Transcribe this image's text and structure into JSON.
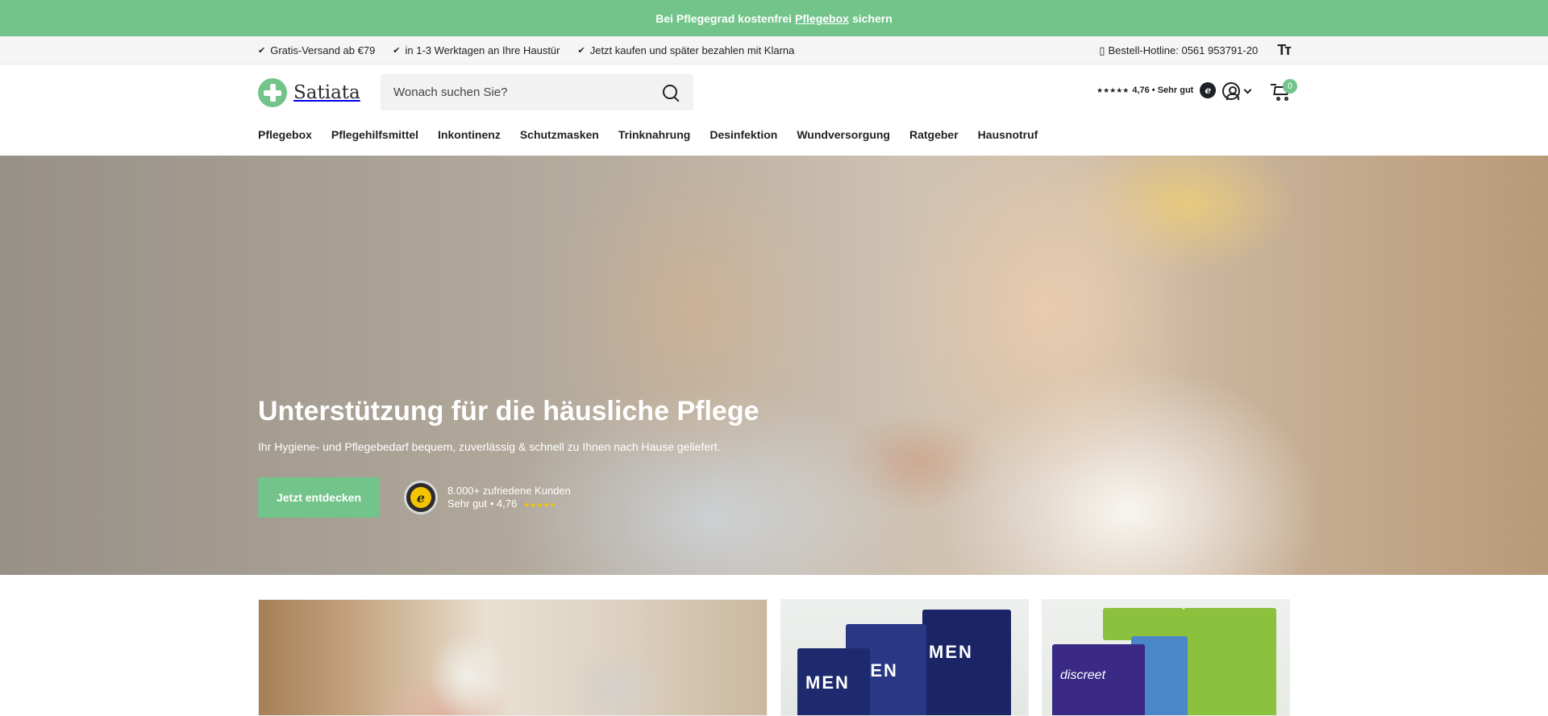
{
  "announcement": {
    "prefix": "Bei Pflegegrad kostenfrei",
    "link": "Pflegebox",
    "suffix": "sichern"
  },
  "usp": {
    "items": [
      "Gratis-Versand ab €79",
      "in 1-3 Werktagen an Ihre Haustür",
      "Jetzt kaufen und später bezahlen mit Klarna"
    ],
    "hotline_icon": "phone-icon",
    "hotline": "Bestell-Hotline: 0561 953791-20",
    "text_size_label": "Tт"
  },
  "header": {
    "logo_text": "Satiata",
    "search": {
      "placeholder": "Wonach suchen Sie?"
    },
    "rating": {
      "stars": "★★★★★",
      "text": "4,76 • Sehr gut",
      "badge": "e"
    },
    "cart_count": "0"
  },
  "nav": {
    "items": [
      "Pflegebox",
      "Pflegehilfsmittel",
      "Inkontinenz",
      "Schutzmasken",
      "Trinknahrung",
      "Desinfektion",
      "Wundversorgung",
      "Ratgeber",
      "Hausnotruf"
    ]
  },
  "hero": {
    "title": "Unterstützung für die häusliche Pflege",
    "subtitle": "Ihr Hygiene- und Pflegebedarf bequem, zuverlässig & schnell zu Ihnen nach Hause geliefert.",
    "cta": "Jetzt entdecken",
    "trust_line1": "8.000+ zufriedene Kunden",
    "trust_line2": "Sehr gut • 4,76",
    "trust_stars": "★★★★★",
    "trust_seal": "e"
  },
  "cards": {
    "pack_labels": [
      "MEN",
      "MEN",
      "MEN",
      "discreet"
    ]
  },
  "colors": {
    "accent": "#72c48a",
    "text": "#1e2125",
    "topbar": "#f5f5f5"
  }
}
